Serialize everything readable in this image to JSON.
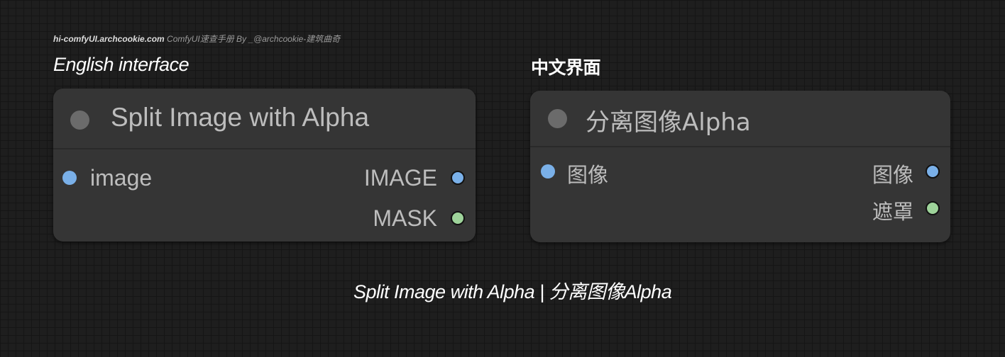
{
  "watermark": {
    "site": "hi-comfyUI.archcookie.com",
    "rest": " ComfyUI速查手册  By _@archcookie-建筑曲奇"
  },
  "labels": {
    "english": "English interface",
    "chinese": "中文界面"
  },
  "nodes": {
    "english": {
      "title": "Split Image with Alpha",
      "input": "image",
      "outputs": [
        "IMAGE",
        "MASK"
      ]
    },
    "chinese": {
      "title": "分离图像Alpha",
      "input": "图像",
      "outputs": [
        "图像",
        "遮罩"
      ]
    }
  },
  "caption": "Split Image with Alpha | 分离图像Alpha",
  "colors": {
    "background": "#1e1e1e",
    "node_body": "#353535",
    "image_slot": "#7ab0e8",
    "mask_slot": "#9ed39a"
  }
}
